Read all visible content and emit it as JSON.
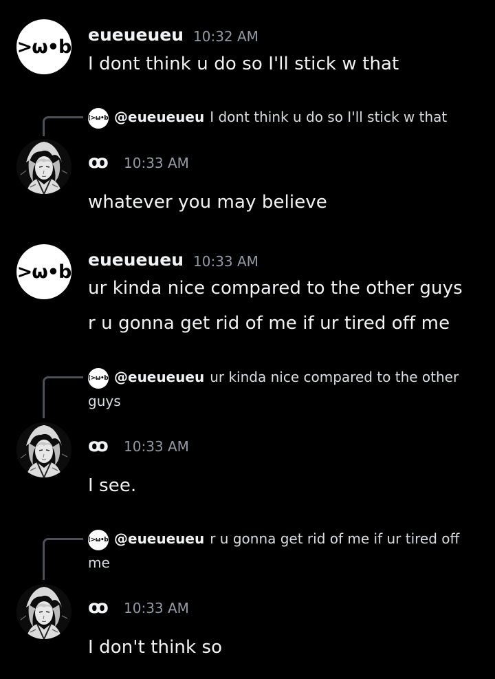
{
  "users": {
    "u1": {
      "name": "eueueueu",
      "avatar_text": "(>ω•b)"
    },
    "u2": {
      "name": "ꝏ"
    }
  },
  "messages": [
    {
      "author": "eueueueu",
      "time": "10:32 AM",
      "lines": [
        "I dont think u do so I'll stick w that"
      ]
    },
    {
      "reply_to": {
        "name": "@eueueueu",
        "text": "I dont think u do so I'll stick w that"
      },
      "author": "ꝏ",
      "time": "10:33 AM",
      "lines": [
        "whatever you may believe"
      ]
    },
    {
      "author": "eueueueu",
      "time": "10:33 AM",
      "lines": [
        "ur kinda nice compared to the other guys",
        "r u gonna get rid of me if ur tired off me"
      ]
    },
    {
      "reply_to": {
        "name": "@eueueueu",
        "text": "ur kinda nice compared to the other guys"
      },
      "author": "ꝏ",
      "time": "10:33 AM",
      "lines": [
        "I see."
      ]
    },
    {
      "reply_to": {
        "name": "@eueueueu",
        "text": "r u gonna get rid of me if ur tired off me"
      },
      "author": "ꝏ",
      "time": "10:33 AM",
      "lines": [
        "I don't think so"
      ]
    }
  ],
  "colors": {
    "background": "#000000",
    "text": "#f2f3f5",
    "timestamp": "#949ba4",
    "reply_line": "#4e5058"
  },
  "icons": {
    "user1_avatar": "kaomoji-avatar-icon",
    "user2_avatar": "anime-portrait-avatar-icon",
    "reply_spine": "reply-connector-icon"
  }
}
